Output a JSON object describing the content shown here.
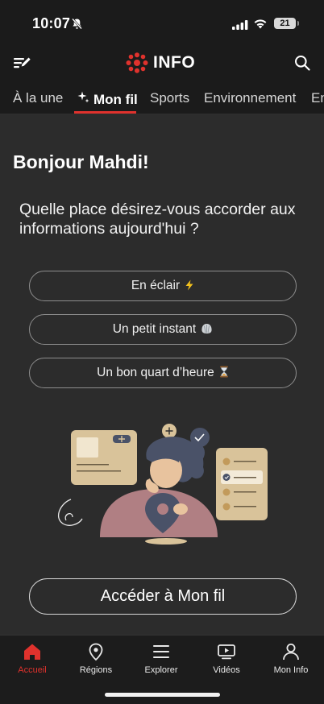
{
  "status": {
    "time": "10:07",
    "battery": "21"
  },
  "header": {
    "brand_name": "INFO"
  },
  "tabs": [
    {
      "label": "À la une",
      "active": false
    },
    {
      "label": "Mon fil",
      "active": true
    },
    {
      "label": "Sports",
      "active": false
    },
    {
      "label": "Environnement",
      "active": false
    },
    {
      "label": "En",
      "active": false
    }
  ],
  "main": {
    "greeting": "Bonjour Mahdi!",
    "question": "Quelle place désirez-vous accorder aux informations aujourd'hui ?",
    "choices": [
      {
        "label": "En éclair",
        "emoji": "⚡"
      },
      {
        "label": "Un petit instant",
        "emoji": "🐚"
      },
      {
        "label": "Un bon quart d’heure",
        "emoji": "⏳"
      }
    ],
    "cta_label": "Accéder à Mon fil"
  },
  "bottom_nav": [
    {
      "label": "Accueil",
      "icon": "home-icon",
      "active": true
    },
    {
      "label": "Régions",
      "icon": "location-pin-icon",
      "active": false
    },
    {
      "label": "Explorer",
      "icon": "menu-lines-icon",
      "active": false
    },
    {
      "label": "Vidéos",
      "icon": "video-icon",
      "active": false
    },
    {
      "label": "Mon Info",
      "icon": "user-icon",
      "active": false
    }
  ],
  "colors": {
    "accent": "#e0322d",
    "background": "#2c2c2c",
    "illustration_card": "#d9c39a",
    "illustration_person": "#b07f83",
    "illustration_pin": "#4a5268"
  }
}
